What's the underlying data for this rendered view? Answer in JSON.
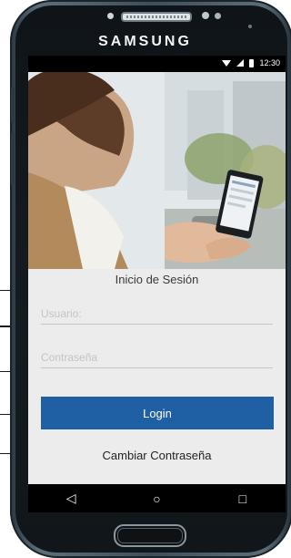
{
  "device": {
    "brand": "SAMSUNG"
  },
  "status_bar": {
    "time": "12:30"
  },
  "login": {
    "title": "Inicio de Sesión",
    "username_placeholder": "Usuario:",
    "password_placeholder": "Contraseña",
    "login_label": "Login",
    "change_password_label": "Cambiar Contraseña"
  },
  "nav": {
    "back_icon": "◁",
    "home_icon": "○",
    "recents_icon": "□"
  },
  "colors": {
    "primary_button": "#1f5fa4",
    "screen_background": "#ececec"
  }
}
